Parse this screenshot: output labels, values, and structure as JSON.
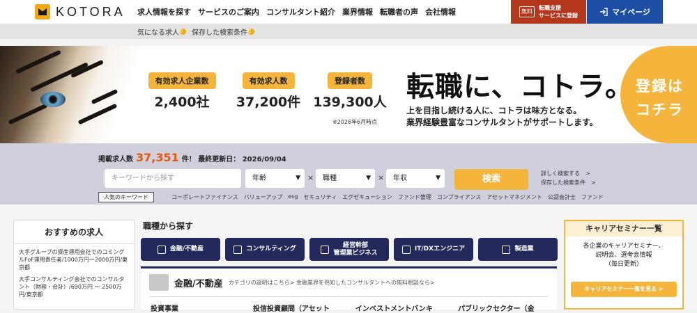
{
  "header": {
    "logo": "KOTORA",
    "nav": [
      "求人情報を探す",
      "サービスのご案内",
      "コンサルタント紹介",
      "業界情報",
      "転職者の声",
      "会社情報"
    ],
    "register": {
      "free": "無料",
      "line1": "転職支援",
      "line2": "サービスに登録"
    },
    "mypage": "マイページ"
  },
  "subbar": {
    "items": [
      "気になる求人",
      "保存した検索条件"
    ],
    "badges": [
      "0",
      "0"
    ]
  },
  "hero": {
    "stats": [
      {
        "label": "有効求人企業数",
        "value": "2,400社"
      },
      {
        "label": "有効求人数",
        "value": "37,200件"
      },
      {
        "label": "登録者数",
        "value": "139,300人"
      }
    ],
    "as_of": "※2026年6月時点",
    "catch": "転職に、コトラ。",
    "sub1": "上を目指し続ける人に、コトラは味方となる。",
    "sub2": "業界経験豊富なコンサルタントがサポートします。",
    "signup": {
      "line1": "登録は",
      "line2": "コチラ"
    }
  },
  "search": {
    "count_prefix": "掲載求人数",
    "count": "37,351",
    "count_suffix": "件！ 最終更新日： 2026/09/04",
    "keyword_placeholder": "キーワードから探す",
    "selects": [
      "年齢",
      "職種",
      "年収"
    ],
    "button": "検索",
    "advanced": "詳しく検索する　>",
    "saved": "保存した検索条件　>",
    "popular_label": "人気のキーワード",
    "keywords": [
      "コーポレートファイナンス",
      "バリューアップ",
      "esg",
      "セキュリティ",
      "エグゼキューション",
      "ファンド管理",
      "コンプライアンス",
      "アセットマネジメント",
      "公認会計士",
      "ファンド"
    ]
  },
  "recommended": {
    "title": "おすすめの求人",
    "items": [
      "大手グループの資産運用会社でのコミングルFoF運用責任者/1000万円〜2000万円/東京都",
      "大手コンサルティング会社でのコンサルタント（財務・会計）/690万円 〜 2500万円/東京都"
    ]
  },
  "categories": {
    "title": "職種から探す",
    "items": [
      "金融/不動産",
      "コンサルティング",
      "経営幹部\n管理業ビジネス",
      "IT/DXエンジニア",
      "製造業"
    ],
    "icons": [
      "coins-icon",
      "monitor-icon",
      "chart-icon",
      "tools-icon",
      "factory-icon"
    ]
  },
  "panel": {
    "title": "金融/不動産",
    "desc": "カテゴリの説明はこちら> 金融業界を熟知したコンサルタントへの無料相談なら>",
    "links": [
      "投資事業",
      "投信投資顧問（アセット",
      "インベストメントバンキ",
      "パブリックセクター（金"
    ]
  },
  "seminar": {
    "title": "キャリアセミナー一覧",
    "desc1": "各企業のキャリアセミナー、",
    "desc2": "説明会、選考会情報",
    "desc3": "（毎日更新）",
    "button": "キャリアセミナー一覧を見る >"
  }
}
